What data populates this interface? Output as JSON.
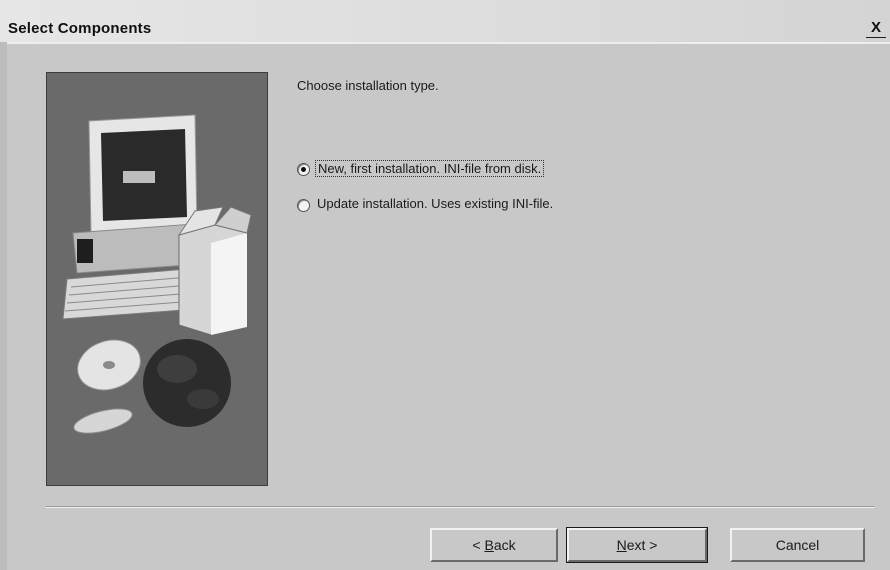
{
  "window": {
    "title": "Select Components",
    "close_label": "X"
  },
  "main": {
    "prompt": "Choose installation type.",
    "options": [
      {
        "label": "New, first installation. INI-file from disk.",
        "selected": true
      },
      {
        "label": "Update installation. Uses existing INI-file.",
        "selected": false
      }
    ]
  },
  "footer": {
    "back": {
      "prefix": "< ",
      "mnemonic": "B",
      "rest": "ack"
    },
    "next": {
      "mnemonic": "N",
      "rest": "ext >"
    },
    "cancel": "Cancel"
  },
  "illustration": {
    "icon": "computer-package-cd-globe-illustration"
  }
}
